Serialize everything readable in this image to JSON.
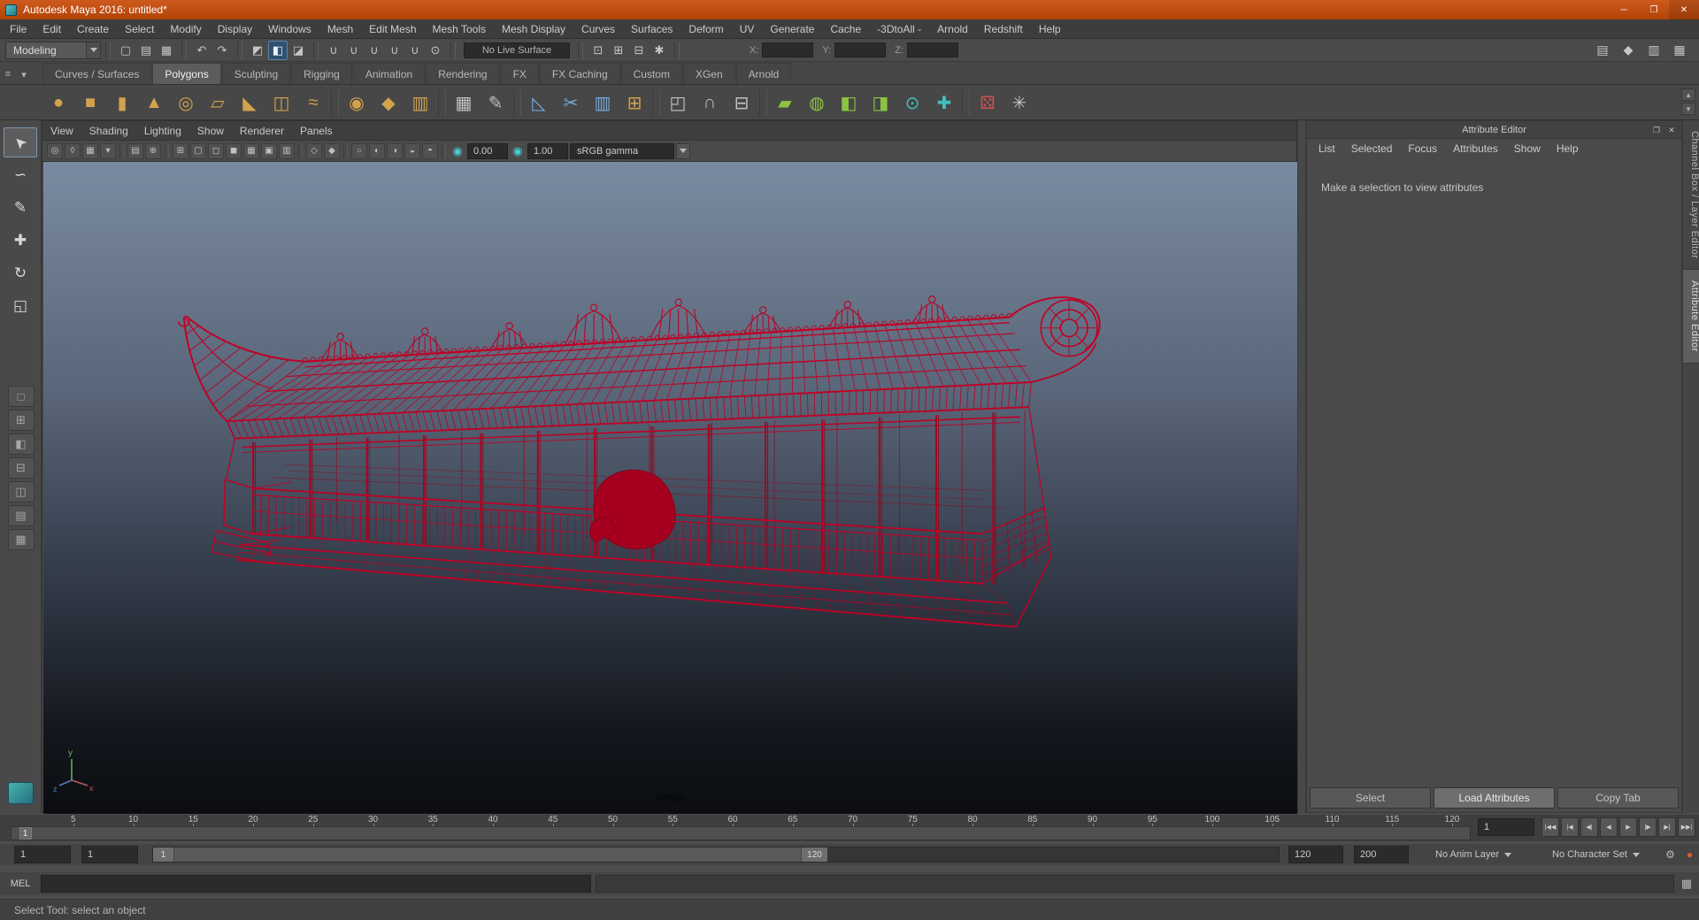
{
  "palette": {
    "gold": "#d2a24c",
    "green": "#8cc441",
    "teal": "#43bdbd",
    "blue": "#72aadc",
    "gray": "#c2c2c2",
    "red": "#d05050",
    "accent_orange": "#c0511b",
    "wire_red": "#c00024"
  },
  "window": {
    "title": "Autodesk Maya 2016: untitled*",
    "minimize_glyph": "─",
    "maximize_glyph": "❐",
    "close_glyph": "✕"
  },
  "menubar": {
    "items": [
      "File",
      "Edit",
      "Create",
      "Select",
      "Modify",
      "Display",
      "Windows",
      "Mesh",
      "Edit Mesh",
      "Mesh Tools",
      "Mesh Display",
      "Curves",
      "Surfaces",
      "Deform",
      "UV",
      "Generate",
      "Cache",
      "-3DtoAll -",
      "Arnold",
      "Redshift",
      "Help"
    ]
  },
  "statusline": {
    "menuset": "Modeling",
    "live_surface": "No Live Surface",
    "coords": {
      "x_label": "X:",
      "y_label": "Y:",
      "z_label": "Z:",
      "x_value": "",
      "y_value": "",
      "z_value": ""
    },
    "groups_left": [
      {
        "icons": [
          {
            "n": "new-scene-icon",
            "g": "▢"
          },
          {
            "n": "open-scene-icon",
            "g": "▤"
          },
          {
            "n": "save-scene-icon",
            "g": "▦"
          }
        ]
      },
      {
        "icons": [
          {
            "n": "undo-icon",
            "g": "↶"
          },
          {
            "n": "redo-icon",
            "g": "↷"
          }
        ]
      },
      {
        "icons": [
          {
            "n": "select-hierarchy-icon",
            "g": "◩"
          },
          {
            "n": "select-object-icon",
            "g": "◧",
            "active": true
          },
          {
            "n": "select-component-icon",
            "g": "◪"
          }
        ]
      },
      {
        "icons": [
          {
            "n": "snap-grid-icon",
            "g": "∪"
          },
          {
            "n": "snap-curve-icon",
            "g": "∪"
          },
          {
            "n": "snap-point-icon",
            "g": "∪"
          },
          {
            "n": "snap-projected-center-icon",
            "g": "∪"
          },
          {
            "n": "snap-view-plane-icon",
            "g": "∪"
          },
          {
            "n": "make-object-live-icon",
            "g": "⊙"
          }
        ]
      }
    ],
    "groups_right": [
      {
        "icons": [
          {
            "n": "render-view-icon",
            "g": "⊡"
          },
          {
            "n": "render-current-frame-icon",
            "g": "⊞"
          },
          {
            "n": "ipr-render-icon",
            "g": "⊟"
          },
          {
            "n": "render-settings-icon",
            "g": "✱"
          }
        ]
      }
    ],
    "right_icons": [
      {
        "n": "raise-panels-icon",
        "g": "▤"
      },
      {
        "n": "modeling-toolkit-icon",
        "g": "◆"
      },
      {
        "n": "channel-box-toggle-icon",
        "g": "▥"
      },
      {
        "n": "attribute-editor-toggle-icon",
        "g": "▦"
      }
    ]
  },
  "shelf": {
    "menu_glyph": "≡",
    "options_glyph": "▾",
    "scroll_up_glyph": "▴",
    "scroll_down_glyph": "▾",
    "tabs": [
      {
        "label": "Curves / Surfaces"
      },
      {
        "label": "Polygons",
        "active": true
      },
      {
        "label": "Sculpting"
      },
      {
        "label": "Rigging"
      },
      {
        "label": "Animation"
      },
      {
        "label": "Rendering"
      },
      {
        "label": "FX"
      },
      {
        "label": "FX Caching"
      },
      {
        "label": "Custom"
      },
      {
        "label": "XGen"
      },
      {
        "label": "Arnold"
      }
    ],
    "icons": [
      {
        "n": "poly-sphere-icon",
        "g": "●",
        "c": "gold"
      },
      {
        "n": "poly-cube-icon",
        "g": "■",
        "c": "gold"
      },
      {
        "n": "poly-cylinder-icon",
        "g": "▮",
        "c": "gold"
      },
      {
        "n": "poly-cone-icon",
        "g": "▲",
        "c": "gold"
      },
      {
        "n": "poly-torus-icon",
        "g": "◎",
        "c": "gold"
      },
      {
        "n": "poly-plane-icon",
        "g": "▱",
        "c": "gold"
      },
      {
        "n": "poly-pyramid-icon",
        "g": "◣",
        "c": "gold"
      },
      {
        "n": "poly-pipe-icon",
        "g": "◫",
        "c": "gold"
      },
      {
        "n": "poly-helix-icon",
        "g": "≈",
        "c": "gold"
      },
      {
        "sep": true
      },
      {
        "n": "sphere-smooth-icon",
        "g": "◉",
        "c": "gold"
      },
      {
        "n": "platonic-solid-icon",
        "g": "◆",
        "c": "gold"
      },
      {
        "n": "sculpt-columns-icon",
        "g": "▥",
        "c": "gold"
      },
      {
        "sep": true
      },
      {
        "n": "uv-grid-icon",
        "g": "▦",
        "c": "gray"
      },
      {
        "n": "create-polygon-icon",
        "g": "✎",
        "c": "gray"
      },
      {
        "sep": true
      },
      {
        "n": "slide-edge-icon",
        "g": "◺",
        "c": "blue"
      },
      {
        "n": "multi-cut-icon",
        "g": "✂",
        "c": "blue"
      },
      {
        "n": "insert-edge-loop-icon",
        "g": "▥",
        "c": "blue"
      },
      {
        "n": "extrude-icon",
        "g": "⊞",
        "c": "gold"
      },
      {
        "sep": true
      },
      {
        "n": "bevel-icon",
        "g": "◰",
        "c": "gray"
      },
      {
        "n": "bridge-icon",
        "g": "∩",
        "c": "gray"
      },
      {
        "n": "boolean-icon",
        "g": "⊟",
        "c": "gray"
      },
      {
        "sep": true
      },
      {
        "n": "quad-draw-icon",
        "g": "▰",
        "c": "green"
      },
      {
        "n": "make-live-icon",
        "g": "◍",
        "c": "green"
      },
      {
        "n": "mirror-icon",
        "g": "◧",
        "c": "green"
      },
      {
        "n": "symmetrize-icon",
        "g": "◨",
        "c": "green"
      },
      {
        "n": "target-weld-icon",
        "g": "⊙",
        "c": "teal"
      },
      {
        "n": "connect-icon",
        "g": "✚",
        "c": "teal"
      },
      {
        "sep": true
      },
      {
        "n": "random-dice-icon",
        "g": "⚄",
        "c": "red"
      },
      {
        "n": "node-network-icon",
        "g": "✳",
        "c": "gray"
      }
    ]
  },
  "toolbox": {
    "tools": [
      {
        "n": "select-tool",
        "g": "➤",
        "rot": -135,
        "active": true
      },
      {
        "n": "lasso-tool",
        "g": "∽"
      },
      {
        "n": "paint-select-tool",
        "g": "✎"
      },
      {
        "n": "move-tool",
        "g": "✚"
      },
      {
        "n": "rotate-tool",
        "g": "↻"
      },
      {
        "n": "scale-tool",
        "g": "◱"
      }
    ],
    "layouts": [
      {
        "n": "single-pane-layout",
        "g": "□"
      },
      {
        "n": "four-pane-layout",
        "g": "⊞"
      },
      {
        "n": "persp-outliner-layout",
        "g": "◧"
      },
      {
        "n": "top-persp-layout",
        "g": "⊟"
      },
      {
        "n": "persp-graph-layout",
        "g": "◫"
      },
      {
        "n": "hypershade-persp-layout",
        "g": "▤"
      },
      {
        "n": "sculpting-layout",
        "g": "▦"
      }
    ]
  },
  "viewport": {
    "panel_menus": [
      "View",
      "Shading",
      "Lighting",
      "Show",
      "Renderer",
      "Panels"
    ],
    "toolbar_icons": [
      {
        "n": "select-camera-icon",
        "g": "◎"
      },
      {
        "n": "lock-camera-icon",
        "g": "◊"
      },
      {
        "n": "camera-attributes-icon",
        "g": "▦"
      },
      {
        "n": "bookmarks-icon",
        "g": "▾"
      },
      {
        "sep": true
      },
      {
        "n": "image-plane-icon",
        "g": "▤"
      },
      {
        "n": "2d-pan-zoom-icon",
        "g": "⊕"
      },
      {
        "sep": true
      },
      {
        "n": "grid-icon",
        "g": "⊞"
      },
      {
        "n": "film-gate-icon",
        "g": "▢"
      },
      {
        "n": "resolution-gate-icon",
        "g": "◻"
      },
      {
        "n": "gate-mask-icon",
        "g": "◼"
      },
      {
        "n": "field-chart-icon",
        "g": "▦"
      },
      {
        "n": "safe-action-icon",
        "g": "▣"
      },
      {
        "n": "safe-title-icon",
        "g": "▥"
      },
      {
        "sep": true
      },
      {
        "n": "frame-all-icon",
        "g": "◇"
      },
      {
        "n": "frame-selection-icon",
        "g": "◆"
      },
      {
        "sep": true
      },
      {
        "n": "lighting-all-icon",
        "g": "○"
      },
      {
        "n": "lighting-default-icon",
        "g": "◐"
      },
      {
        "n": "shadows-icon",
        "g": "◑"
      },
      {
        "n": "ambient-occlusion-icon",
        "g": "◒"
      },
      {
        "n": "motion-blur-icon",
        "g": "◓"
      },
      {
        "sep": true
      }
    ],
    "exposure_icon": "◉",
    "exposure": "0.00",
    "gamma_icon": "◉",
    "gamma": "1.00",
    "colorspace": "sRGB gamma",
    "camera": "persp",
    "axis": {
      "x": "x",
      "y": "y",
      "z": "z"
    }
  },
  "attribute_editor": {
    "title": "Attribute Editor",
    "header_icons": [
      {
        "n": "float-panel-icon",
        "g": "❐"
      },
      {
        "n": "close-panel-icon",
        "g": "✕"
      }
    ],
    "menus": [
      "List",
      "Selected",
      "Focus",
      "Attributes",
      "Show",
      "Help"
    ],
    "message": "Make a selection to view attributes",
    "buttons": [
      {
        "n": "select-button",
        "label": "Select"
      },
      {
        "n": "load-attributes-button",
        "label": "Load Attributes",
        "active": true
      },
      {
        "n": "copy-tab-button",
        "label": "Copy Tab"
      }
    ]
  },
  "sidebar": {
    "tabs": [
      {
        "n": "channel-box-layer-editor-tab",
        "label": "Channel Box / Layer Editor"
      },
      {
        "n": "attribute-editor-tab",
        "label": "Attribute Editor",
        "active": true
      }
    ]
  },
  "timeline": {
    "labels": [
      5,
      10,
      15,
      20,
      25,
      30,
      35,
      40,
      45,
      50,
      55,
      60,
      65,
      70,
      75,
      80,
      85,
      90,
      95,
      100,
      105,
      110,
      115,
      120
    ],
    "current_frame": "1",
    "frame_field_value": "1"
  },
  "playback": {
    "buttons": [
      {
        "n": "go-to-start-button",
        "g": "|◀◀"
      },
      {
        "n": "step-back-frame-button",
        "g": "|◀"
      },
      {
        "n": "step-back-key-button",
        "g": "◀|"
      },
      {
        "n": "play-backwards-button",
        "g": "◀"
      },
      {
        "n": "play-forwards-button",
        "g": "▶"
      },
      {
        "n": "step-forward-key-button",
        "g": "|▶"
      },
      {
        "n": "step-forward-frame-button",
        "g": "▶|"
      },
      {
        "n": "go-to-end-button",
        "g": "▶▶|"
      }
    ]
  },
  "range_slider": {
    "anim_start": "1",
    "playback_start": "1",
    "handle_start": "1",
    "handle_end": "120",
    "playback_end": "120",
    "anim_end": "200",
    "anim_layer": "No Anim Layer",
    "character_set": "No Character Set",
    "icons": [
      {
        "n": "anim-preferences-icon",
        "g": "⚙",
        "c": "#b8b8b8"
      },
      {
        "n": "auto-key-icon",
        "g": "●",
        "c": "#e05a30"
      }
    ]
  },
  "command_line": {
    "label": "MEL",
    "input_value": "",
    "result_value": "",
    "icon": {
      "n": "script-editor-icon",
      "g": "▦"
    }
  },
  "help_line": {
    "text": "Select Tool: select an object"
  }
}
